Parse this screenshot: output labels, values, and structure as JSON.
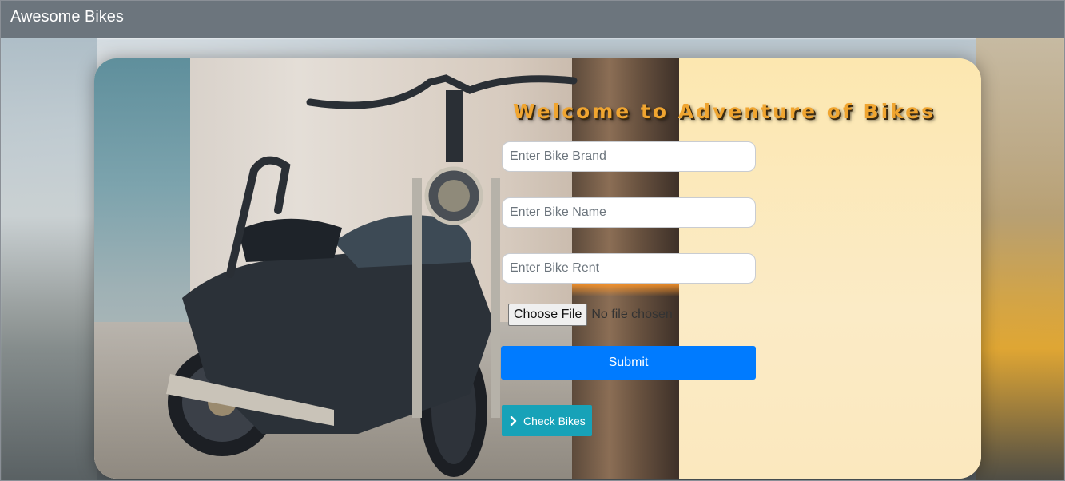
{
  "navbar": {
    "brand": "Awesome Bikes"
  },
  "hero": {
    "title": "Welcome to Adventure of Bikes"
  },
  "form": {
    "brand_placeholder": "Enter Bike Brand",
    "name_placeholder": "Enter Bike Name",
    "rent_placeholder": "Enter Bike Rent",
    "file_button_label": "Choose File",
    "file_status": "No file chosen",
    "submit_label": "Submit"
  },
  "actions": {
    "check_bikes_label": "Check Bikes",
    "check_bikes_icon": "chevron-right-icon"
  },
  "colors": {
    "navbar": "#6c757d",
    "submit": "#007bff",
    "check_bikes": "#17a2b8",
    "title": "#f0a530",
    "panel": "#fbe8b6"
  }
}
